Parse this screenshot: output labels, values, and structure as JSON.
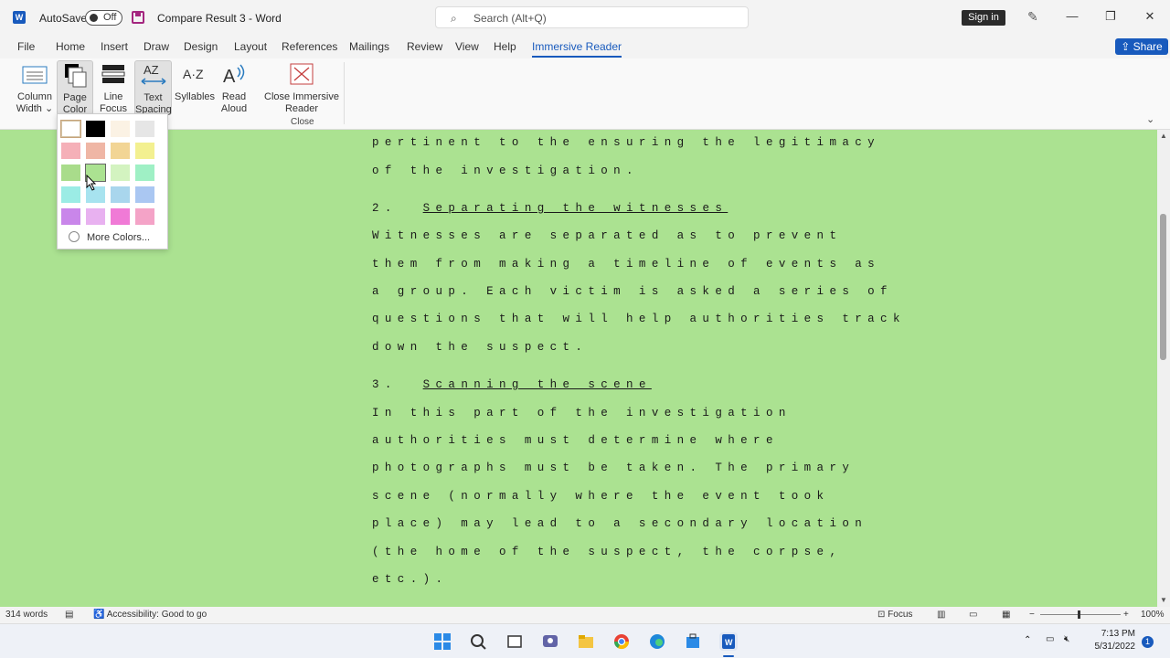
{
  "titlebar": {
    "autosave_label": "AutoSave",
    "autosave_state": "Off",
    "document_title": "Compare Result 3 - Word",
    "search_placeholder": "Search (Alt+Q)",
    "signin_label": "Sign in"
  },
  "menu": {
    "tabs": [
      "File",
      "Home",
      "Insert",
      "Draw",
      "Design",
      "Layout",
      "References",
      "Mailings",
      "Review",
      "View",
      "Help",
      "Immersive Reader"
    ],
    "active_tab": "Immersive Reader",
    "share_label": "Share"
  },
  "ribbon": {
    "buttons": [
      {
        "label1": "Column",
        "label2": "Width ⌄"
      },
      {
        "label1": "Page",
        "label2": "Color ⌄"
      },
      {
        "label1": "Line",
        "label2": "Focus ⌄"
      },
      {
        "label1": "Text",
        "label2": "Spacing"
      },
      {
        "label1": "Syllables",
        "label2": ""
      },
      {
        "label1": "Read",
        "label2": "Aloud"
      },
      {
        "label1": "Close Immersive",
        "label2": "Reader"
      }
    ],
    "group_close_label": "Close"
  },
  "dropdown": {
    "more_colors_label": "More Colors...",
    "swatches": [
      [
        "#ffffff",
        "#000000",
        "#fbf2e4",
        "#e6e6e6"
      ],
      [
        "#f5b0b8",
        "#efb6a5",
        "#f2d595",
        "#f3f090"
      ],
      [
        "#a9dc8b",
        "#abe291",
        "#d3f3c0",
        "#9ff0c5"
      ],
      [
        "#9bece5",
        "#a7e3ef",
        "#a9d6ed",
        "#aac7f2"
      ],
      [
        "#c986ea",
        "#e8b1f0",
        "#f07ad6",
        "#f4a3c7"
      ]
    ],
    "selected_color": "#ffffff",
    "hovered_color": "#abe291"
  },
  "document": {
    "lines": [
      {
        "text": "pertinent to the ensuring the legitimacy"
      },
      {
        "text": "of the investigation."
      },
      {
        "num": "2.",
        "heading": "Separating the witnesses"
      },
      {
        "text": "Witnesses are separated as to prevent"
      },
      {
        "text": "them from making a timeline of events as"
      },
      {
        "text": "a group. Each victim is asked a series of"
      },
      {
        "text": "questions that will help authorities track"
      },
      {
        "text": "down the suspect."
      },
      {
        "num": "3.",
        "heading": "Scanning the scene"
      },
      {
        "text": "In this part of the investigation"
      },
      {
        "text": "authorities must determine where"
      },
      {
        "text": "photographs must be taken. The primary"
      },
      {
        "text": "scene (normally where the event took"
      },
      {
        "text": "place) may lead to a secondary location"
      },
      {
        "text": "(the home of the suspect, the corpse,"
      },
      {
        "text": "etc.)."
      }
    ],
    "background_color": "#abe291"
  },
  "status": {
    "word_count": "314 words",
    "accessibility": "Accessibility: Good to go",
    "focus_label": "Focus",
    "zoom": "100%"
  },
  "taskbar": {
    "time": "7:13 PM",
    "date": "5/31/2022",
    "notification_count": "1"
  }
}
